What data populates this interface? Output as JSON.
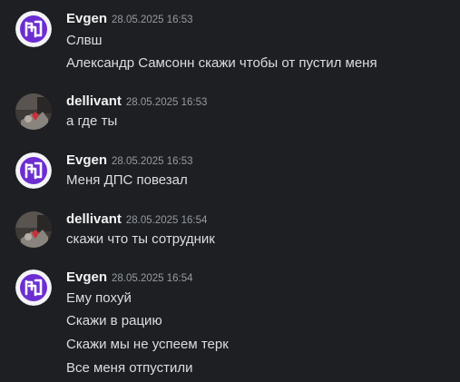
{
  "messages": [
    {
      "author": "Evgen",
      "avatar": "logo-avatar",
      "timestamp": "28.05.2025 16:53",
      "lines": [
        "Слвш",
        "Александр Самсонн скажи чтобы от пустил меня"
      ]
    },
    {
      "author": "dellivant",
      "avatar": "photo-avatar",
      "timestamp": "28.05.2025 16:53",
      "lines": [
        "а где ты"
      ]
    },
    {
      "author": "Evgen",
      "avatar": "logo-avatar",
      "timestamp": "28.05.2025 16:53",
      "lines": [
        "Меня ДПС повезал"
      ]
    },
    {
      "author": "dellivant",
      "avatar": "photo-avatar",
      "timestamp": "28.05.2025 16:54",
      "lines": [
        "скажи что ты сотрудник"
      ]
    },
    {
      "author": "Evgen",
      "avatar": "logo-avatar",
      "timestamp": "28.05.2025 16:54",
      "lines": [
        "Ему похуй",
        "Скажи в рацию",
        "Скажи мы не успеем терк",
        "Все меня отпустили"
      ]
    }
  ],
  "colors": {
    "background": "#1e1f22",
    "text": "#dbdee1",
    "username": "#f2f3f5",
    "timestamp": "#949ba4",
    "logo_purple": "#6c2ed1"
  }
}
